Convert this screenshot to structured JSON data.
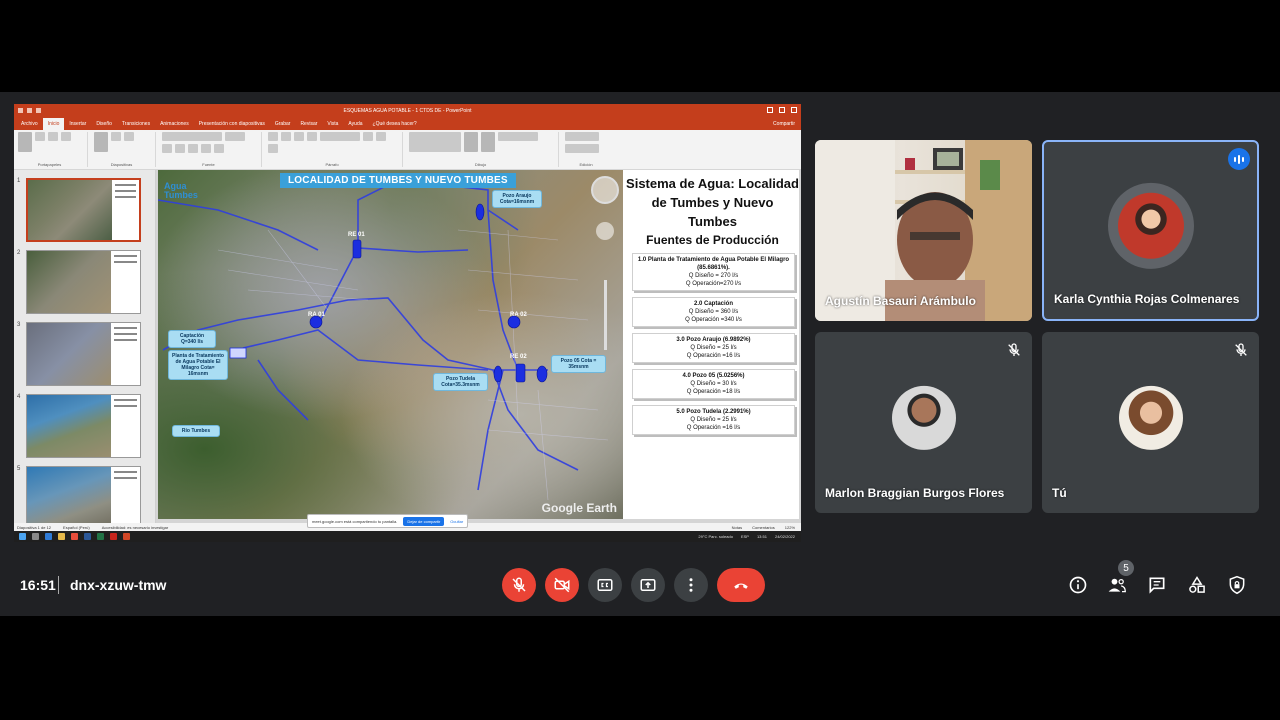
{
  "powerpoint": {
    "window_title": "ESQUEMAS AGUA POTABLE - 1 CTDS DE  - PowerPoint",
    "tabs": [
      "Archivo",
      "Inicio",
      "Insertar",
      "Diseño",
      "Transiciones",
      "Animaciones",
      "Presentación con diapositivas",
      "Grabar",
      "Revisar",
      "Vista",
      "Ayuda",
      "¿Qué desea hacer?"
    ],
    "active_tab": "Inicio",
    "share_label": "Compartir",
    "ribbon_groups": [
      "Portapapeles",
      "Diapositivas",
      "Fuente",
      "Párrafo",
      "Dibujo",
      "Edición"
    ],
    "status_slide": "Diapositiva 1 de 12",
    "status_language": "Español (Perú)",
    "status_accessibility": "Accesibilidad: es necesario investigar",
    "status_notes": "Notas",
    "status_comments": "Comentarios",
    "zoom": "122%",
    "thumbnail_numbers": [
      "1",
      "2",
      "3",
      "4",
      "5"
    ]
  },
  "slide": {
    "banner": "LOCALIDAD DE TUMBES Y NUEVO TUMBES",
    "logo_line1": "Agua",
    "logo_line2": "Tumbes",
    "map_callouts": {
      "pozo_araujo": "Pozo Araujo Cota=16msnm",
      "captacion": "Captación Q=340 l/s",
      "planta": "Planta de Tratamiento de Agua Potable El Milagro Cota= 16msnm",
      "rio": "Río Tumbes",
      "pozo_tudela": "Pozo Tudela Cota=35.3msnm",
      "pozo_05": "Pozo 05 Cota = 35msnm"
    },
    "map_labels": [
      "RE 01",
      "RA 01",
      "RA 02",
      "RE 02"
    ],
    "google_earth": "Google Earth",
    "title": "Sistema de Agua: Localidad de Tumbes y Nuevo Tumbes",
    "subtitle": "Fuentes de Producción",
    "sources": [
      {
        "name": "1.0 Planta de Tratamiento de Agua Potable El Milagro (85.6861%).",
        "diseno": "Q Diseño = 270 l/s",
        "operacion": "Q Operación=270 l/s"
      },
      {
        "name": "2.0 Captación",
        "diseno": "Q Diseño = 360 l/s",
        "operacion": "Q Operación =340 l/s"
      },
      {
        "name": "3.0 Pozo Araujo (6.9892%)",
        "diseno": "Q Diseño = 25 l/s",
        "operacion": "Q Operación =16 l/s"
      },
      {
        "name": "4.0 Pozo 05 (5.0256%)",
        "diseno": "Q Diseño = 30 l/s",
        "operacion": "Q Operación =18 l/s"
      },
      {
        "name": "5.0 Pozo Tudela (2.2991%)",
        "diseno": "Q Diseño = 25 l/s",
        "operacion": "Q Operación =16 l/s"
      }
    ]
  },
  "share_notice": {
    "text": "meet.google.com está compartiendo tu pantalla.",
    "stop": "Dejar de compartir",
    "hide": "Ocultar"
  },
  "taskbar": {
    "weather": "29°C Parc. soleado",
    "lang": "ESP",
    "time": "13:51",
    "date": "24/02/2022"
  },
  "participants": [
    {
      "name": "Agustín Basauri Arámbulo",
      "camera": true,
      "muted": false,
      "speaking": false
    },
    {
      "name": "Karla Cynthia Rojas Colmenares",
      "camera": false,
      "muted": false,
      "speaking": true
    },
    {
      "name": "Marlon Braggian Burgos Flores",
      "camera": false,
      "muted": true,
      "speaking": false
    },
    {
      "name": "Tú",
      "camera": false,
      "muted": true,
      "speaking": false
    }
  ],
  "meeting": {
    "time": "16:51",
    "code": "dnx-xzuw-tmw",
    "participant_count": "5"
  },
  "colors": {
    "meet_bg": "#202124",
    "red": "#ea4335",
    "control_gray": "#3c4043",
    "speaker_blue": "#1a73e8",
    "ppt_orange": "#c43e1c"
  }
}
